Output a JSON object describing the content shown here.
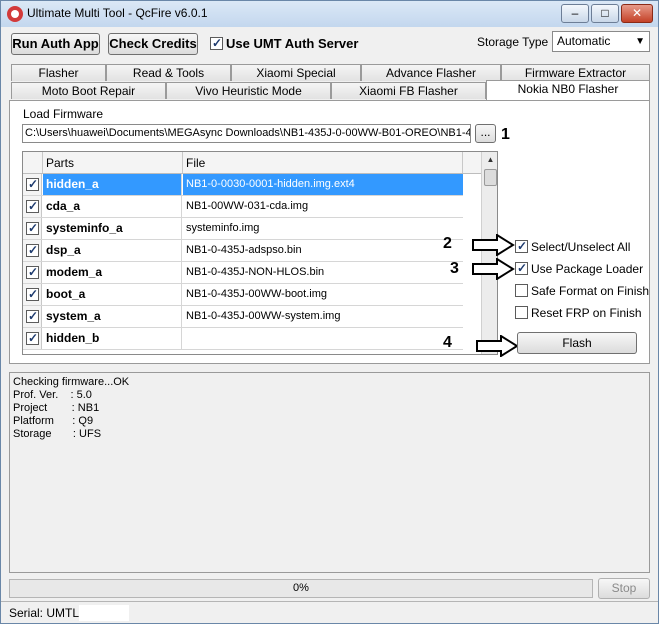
{
  "window": {
    "title": "Ultimate Multi Tool - QcFire v6.0.1",
    "minimize_glyph": "–",
    "maximize_glyph": "□",
    "close_glyph": "✕"
  },
  "toolbar": {
    "run_auth_label": "Run Auth App",
    "check_credits_label": "Check Credits",
    "use_auth_server_label": "Use UMT Auth Server",
    "use_auth_server_checked": true,
    "storage_type_label": "Storage Type",
    "storage_type_value": "Automatic"
  },
  "tabs_row1": [
    "Flasher",
    "Read & Tools",
    "Xiaomi Special",
    "Advance Flasher",
    "Firmware Extractor"
  ],
  "tabs_row2": [
    "Moto Boot Repair",
    "Vivo Heuristic Mode",
    "Xiaomi FB Flasher",
    "Nokia NB0 Flasher"
  ],
  "active_tab": "Nokia NB0 Flasher",
  "load_firmware": {
    "label": "Load Firmware",
    "path": "C:\\Users\\huawei\\Documents\\MEGAsync Downloads\\NB1-435J-0-00WW-B01-OREO\\NB1-4",
    "browse_label": "..."
  },
  "grid": {
    "headers": {
      "parts": "Parts",
      "file": "File"
    },
    "rows": [
      {
        "part": "hidden_a",
        "file": "NB1-0-0030-0001-hidden.img.ext4",
        "checked": true,
        "selected": true
      },
      {
        "part": "cda_a",
        "file": "NB1-00WW-031-cda.img",
        "checked": true,
        "selected": false
      },
      {
        "part": "systeminfo_a",
        "file": "systeminfo.img",
        "checked": true,
        "selected": false
      },
      {
        "part": "dsp_a",
        "file": "NB1-0-435J-adspso.bin",
        "checked": true,
        "selected": false
      },
      {
        "part": "modem_a",
        "file": "NB1-0-435J-NON-HLOS.bin",
        "checked": true,
        "selected": false
      },
      {
        "part": "boot_a",
        "file": "NB1-0-435J-00WW-boot.img",
        "checked": true,
        "selected": false
      },
      {
        "part": "system_a",
        "file": "NB1-0-435J-00WW-system.img",
        "checked": true,
        "selected": false
      },
      {
        "part": "hidden_b",
        "file": "",
        "checked": true,
        "selected": false
      }
    ]
  },
  "options": {
    "select_all_label": "Select/Unselect All",
    "select_all_checked": true,
    "package_loader_label": "Use Package Loader",
    "package_loader_checked": true,
    "safe_format_label": "Safe Format on Finish",
    "safe_format_checked": false,
    "reset_frp_label": "Reset FRP on Finish",
    "reset_frp_checked": false,
    "flash_label": "Flash"
  },
  "annotations": {
    "step1": "1",
    "step2": "2",
    "step3": "3",
    "step4": "4"
  },
  "log_lines": [
    "Checking firmware...OK",
    "Prof. Ver.    : 5.0",
    "Project        : NB1",
    "Platform      : Q9",
    "Storage       : UFS"
  ],
  "progress": {
    "text": "0%",
    "value": 0
  },
  "stop_label": "Stop",
  "status": {
    "serial_label": "Serial: UMTL"
  }
}
